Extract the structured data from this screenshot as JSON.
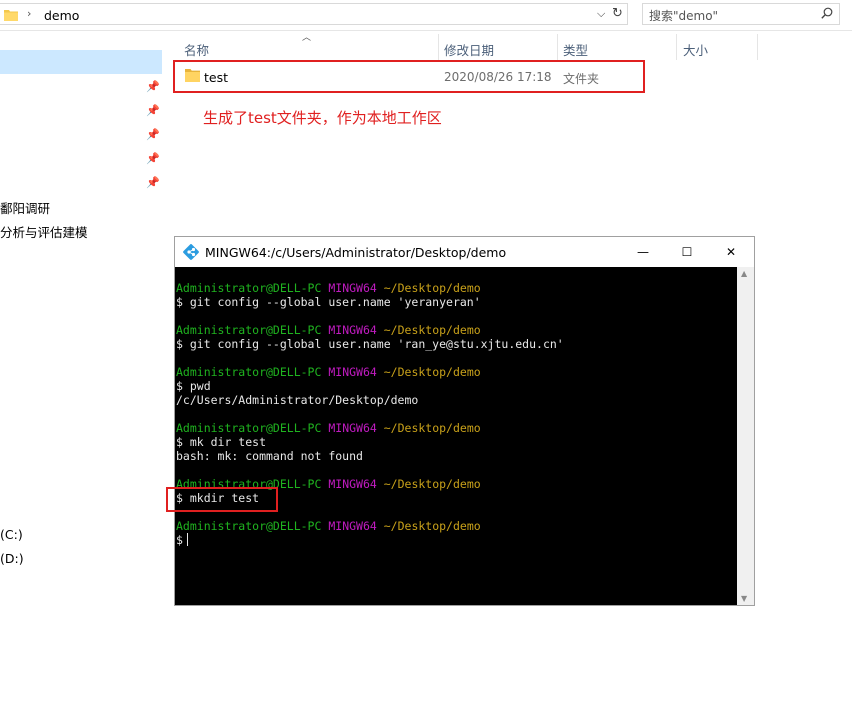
{
  "address_bar": {
    "breadcrumb_separator": "›",
    "current_folder": "demo",
    "search_placeholder": "搜索\"demo\""
  },
  "nav": {
    "items": [
      "鄱阳调研",
      "分析与评估建模",
      "(C:)",
      "(D:)"
    ]
  },
  "file_list": {
    "columns": [
      "名称",
      "修改日期",
      "类型",
      "大小"
    ],
    "rows": [
      {
        "name": "test",
        "date": "2020/08/26 17:18",
        "type": "文件夹"
      }
    ]
  },
  "annotation": "生成了test文件夹，作为本地工作区",
  "terminal": {
    "title": "MINGW64:/c/Users/Administrator/Desktop/demo",
    "prompt_user": "Administrator@DELL-PC",
    "prompt_host": "MINGW64",
    "prompt_path": "~/Desktop/demo",
    "commands": [
      {
        "cmd": "$ git config --global user.name 'yeranyeran'",
        "output": ""
      },
      {
        "cmd": "$ git config --global user.name 'ran_ye@stu.xjtu.edu.cn'",
        "output": ""
      },
      {
        "cmd": "$ pwd",
        "output": "/c/Users/Administrator/Desktop/demo"
      },
      {
        "cmd": "$ mk dir test",
        "output": "bash: mk: command not found"
      },
      {
        "cmd": "$ mkdir test",
        "output": ""
      },
      {
        "cmd": "$",
        "output": ""
      }
    ]
  },
  "colors": {
    "highlight_red": "#e02020",
    "prompt_green": "#1fb31f",
    "prompt_magenta": "#c01bc0",
    "prompt_yellow": "#c8a11a",
    "nav_selected": "#cce8ff"
  }
}
